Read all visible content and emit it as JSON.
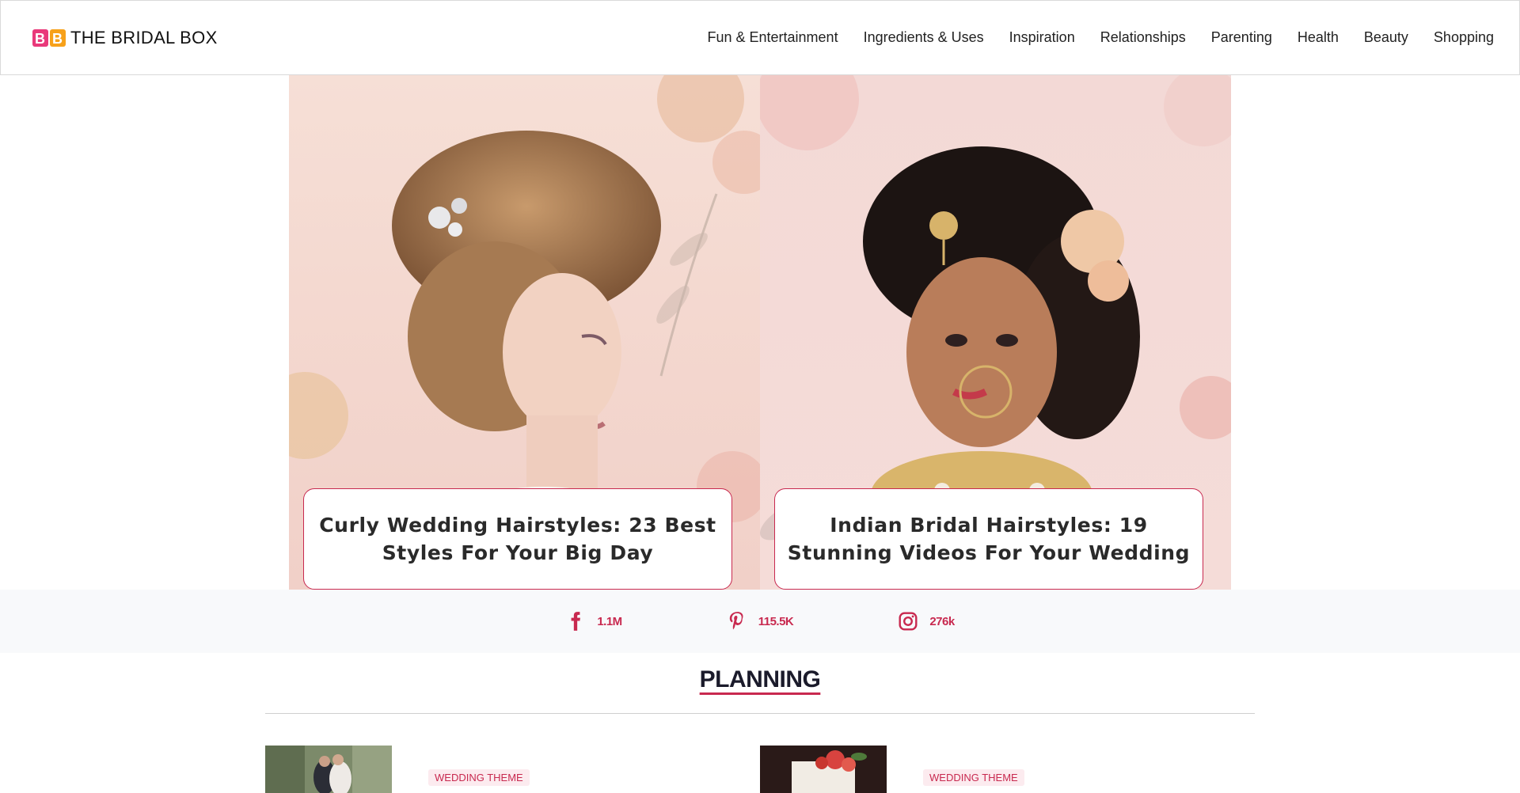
{
  "brand": {
    "name": "THE BRIDAL BOX",
    "logo": "bb-logo-mark"
  },
  "nav": {
    "items": [
      {
        "label": "Fun & Entertainment"
      },
      {
        "label": "Ingredients & Uses"
      },
      {
        "label": "Inspiration"
      },
      {
        "label": "Relationships"
      },
      {
        "label": "Parenting"
      },
      {
        "label": "Health"
      },
      {
        "label": "Beauty"
      },
      {
        "label": "Shopping"
      }
    ]
  },
  "hero": {
    "cards": [
      {
        "title": "Curly Wedding Hairstyles: 23 Best Styles For Your Big Day",
        "image": "bride-curly-updo-photo"
      },
      {
        "title": "Indian Bridal Hairstyles: 19 Stunning Videos For Your Wedding",
        "image": "indian-bride-photo"
      }
    ]
  },
  "social": {
    "items": [
      {
        "icon": "facebook-icon",
        "count": "1.1M"
      },
      {
        "icon": "pinterest-icon",
        "count": "115.5K"
      },
      {
        "icon": "instagram-icon",
        "count": "276k"
      }
    ]
  },
  "planning": {
    "title": "PLANNING",
    "posts": [
      {
        "tag": "WEDDING THEME",
        "image": "wedding-couple-thumbnail"
      },
      {
        "tag": "WEDDING THEME",
        "image": "wedding-cake-thumbnail"
      }
    ]
  },
  "colors": {
    "accent": "#c8294f",
    "heading": "#1b1b2b",
    "strip_bg": "#f8f9fb"
  }
}
